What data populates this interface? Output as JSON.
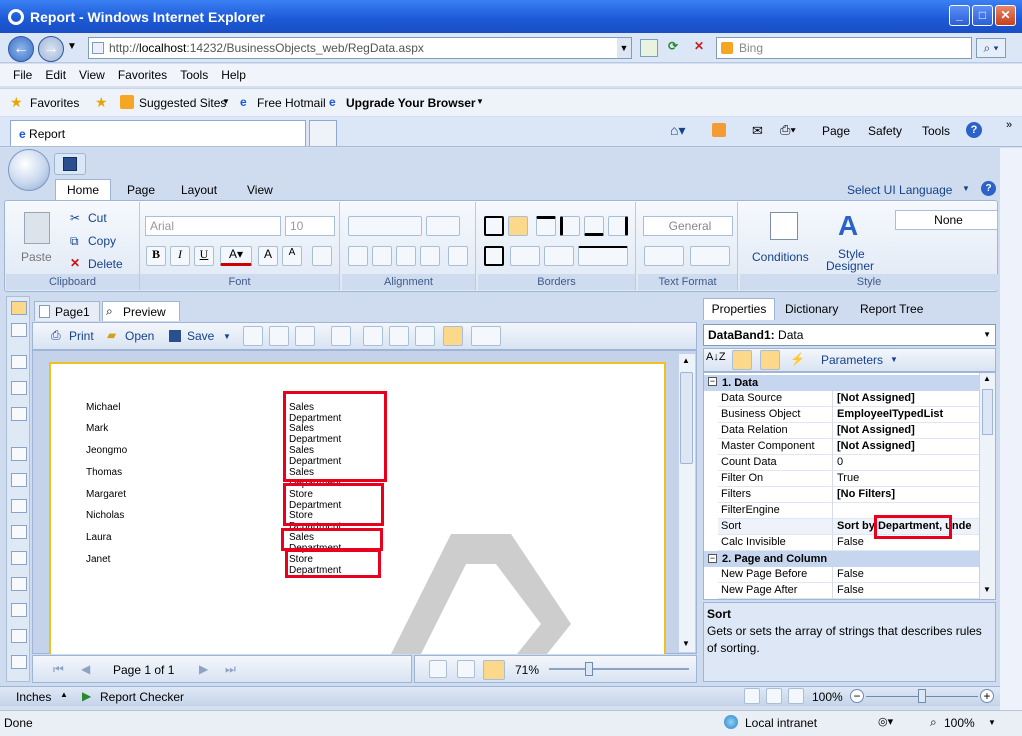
{
  "window": {
    "title": "Report - Windows Internet Explorer"
  },
  "address_bar": {
    "url_prefix": "http://",
    "url_host": "localhost",
    "url_rest": ":14232/BusinessObjects_web/RegData.aspx",
    "search_placeholder": "Bing"
  },
  "menu": [
    "File",
    "Edit",
    "View",
    "Favorites",
    "Tools",
    "Help"
  ],
  "favorites_bar": {
    "favorites": "Favorites",
    "suggested": "Suggested Sites",
    "hotmail": "Free Hotmail",
    "upgrade": "Upgrade Your Browser"
  },
  "tab": {
    "label": "Report"
  },
  "command_bar": {
    "page": "Page",
    "safety": "Safety",
    "tools": "Tools"
  },
  "ribbon": {
    "tabs": [
      "Home",
      "Page",
      "Layout",
      "View"
    ],
    "select_ui_language": "Select UI Language",
    "clipboard": {
      "label": "Clipboard",
      "paste": "Paste",
      "cut": "Cut",
      "copy": "Copy",
      "delete": "Delete"
    },
    "font": {
      "label": "Font",
      "family": "Arial",
      "size": "10"
    },
    "alignment": {
      "label": "Alignment"
    },
    "borders": {
      "label": "Borders"
    },
    "text_format": {
      "label": "Text Format",
      "format": "General"
    },
    "style": {
      "label": "Style",
      "conditions": "Conditions",
      "style_designer_1": "Style",
      "style_designer_2": "Designer",
      "style_value": "None"
    }
  },
  "page_tabs": [
    "Page1",
    "Preview"
  ],
  "preview_toolbar": {
    "print": "Print",
    "open": "Open",
    "save": "Save"
  },
  "report_rows": [
    {
      "name": "Michael",
      "department": "Sales Department"
    },
    {
      "name": "Mark",
      "department": "Sales Department"
    },
    {
      "name": "Jeongmo",
      "department": "Sales Department"
    },
    {
      "name": "Thomas",
      "department": "Sales Department"
    },
    {
      "name": "Margaret",
      "department": "Store Department"
    },
    {
      "name": "Nicholas",
      "department": "Store Department"
    },
    {
      "name": "Laura",
      "department": "Sales Department"
    },
    {
      "name": "Janet",
      "department": "Store Department"
    }
  ],
  "navigation": {
    "page_label": "Page 1 of 1",
    "zoom": "71%"
  },
  "properties_panel": {
    "tabs": [
      "Properties",
      "Dictionary",
      "Report Tree"
    ],
    "component_name": "DataBand1:",
    "component_type": "Data",
    "parameters": "Parameters",
    "categories": [
      {
        "title": "1. Data",
        "rows": [
          {
            "name": "Data Source",
            "value": "[Not Assigned]",
            "bold": true
          },
          {
            "name": "Business Object",
            "value": "EmployeeITypedList",
            "bold": true
          },
          {
            "name": "Data Relation",
            "value": "[Not Assigned]",
            "bold": true
          },
          {
            "name": "Master Component",
            "value": "[Not Assigned]",
            "bold": true
          },
          {
            "name": "Count Data",
            "value": "0",
            "bold": false
          },
          {
            "name": "Filter On",
            "value": "True",
            "bold": false
          },
          {
            "name": "Filters",
            "value": "[No Filters]",
            "bold": true
          },
          {
            "name": "FilterEngine",
            "value": "",
            "bold": false
          },
          {
            "name": "Sort",
            "value": "Sort by Department, unde",
            "bold": true
          },
          {
            "name": "Calc Invisible",
            "value": "False",
            "bold": false
          }
        ]
      },
      {
        "title": "2. Page and Column",
        "rows": [
          {
            "name": "New Page Before",
            "value": "False",
            "bold": false
          },
          {
            "name": "New Page After",
            "value": "False",
            "bold": false
          }
        ]
      }
    ],
    "description": {
      "title": "Sort",
      "text": "Gets or sets the array of strings that describes rules of sorting."
    }
  },
  "designer_status": {
    "units": "Inches",
    "report_checker": "Report Checker",
    "zoom": "100%"
  },
  "ie_status": {
    "done": "Done",
    "zone": "Local intranet",
    "zoom": "100%"
  },
  "colors": {
    "highlight": "#e8001c",
    "title_bar": "#1c58d6",
    "page_border": "#f0c020"
  }
}
